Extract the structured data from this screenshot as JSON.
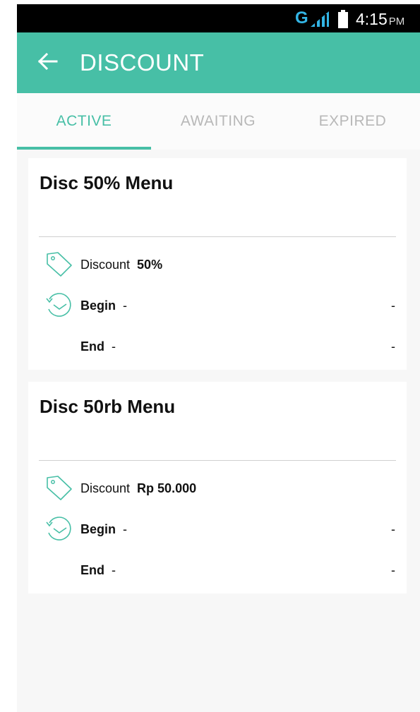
{
  "status": {
    "network": "G",
    "time": "4:15",
    "ampm": "PM"
  },
  "appbar": {
    "title": "DISCOUNT"
  },
  "tabs": [
    {
      "label": "ACTIVE",
      "active": true
    },
    {
      "label": "AWAITING",
      "active": false
    },
    {
      "label": "EXPIRED",
      "active": false
    }
  ],
  "cards": [
    {
      "title": "Disc 50% Menu",
      "discount_label": "Discount",
      "discount_value": "50%",
      "begin_label": "Begin",
      "begin_value": "-",
      "begin_right": "-",
      "end_label": "End",
      "end_value": "-",
      "end_right": "-"
    },
    {
      "title": "Disc 50rb Menu",
      "discount_label": "Discount",
      "discount_value": "Rp 50.000",
      "begin_label": "Begin",
      "begin_value": "-",
      "begin_right": "-",
      "end_label": "End",
      "end_value": "-",
      "end_right": "-"
    }
  ],
  "colors": {
    "accent": "#47bfa6",
    "inactive_tab": "#b8b8b8"
  }
}
